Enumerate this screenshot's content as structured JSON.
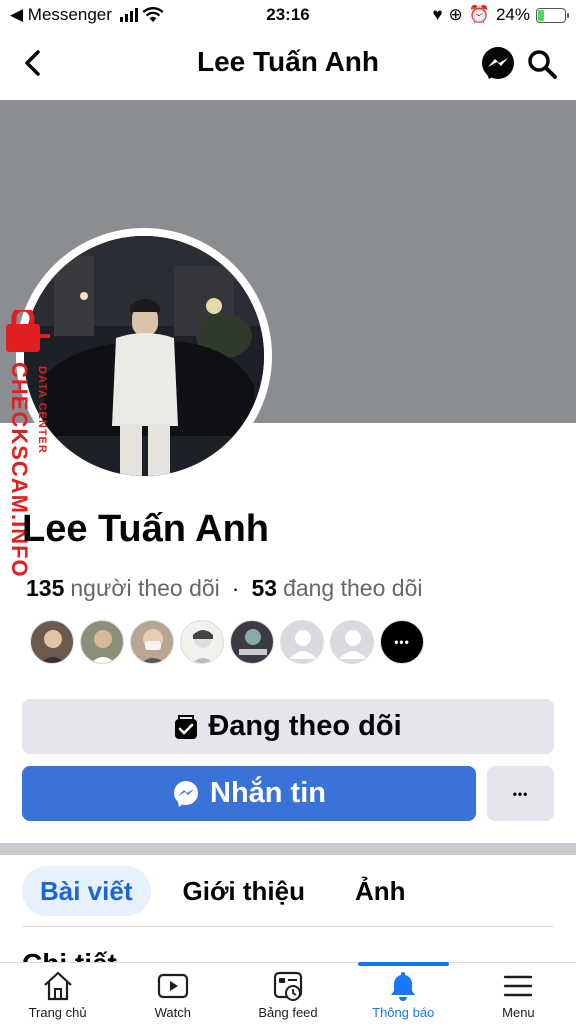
{
  "status_bar": {
    "carrier": "◀ Messenger",
    "time": "23:16",
    "battery": "24%",
    "battery_level": 0.24
  },
  "header": {
    "title": "Lee Tuấn Anh"
  },
  "watermark": {
    "text": "CHECKSCAM.INFO",
    "sub": "DATA CENTER"
  },
  "profile": {
    "name": "Lee Tuấn Anh",
    "followers_count": "135",
    "followers_label": "người theo dõi",
    "following_count": "53",
    "following_label": "đang theo dõi",
    "dot": "·",
    "more_glyph": "•••"
  },
  "buttons": {
    "following": "Đang theo dõi",
    "message": "Nhắn tin",
    "more": "•••"
  },
  "tabs": [
    {
      "label": "Bài viết",
      "active": true
    },
    {
      "label": "Giới thiệu",
      "active": false
    },
    {
      "label": "Ảnh",
      "active": false
    }
  ],
  "section": {
    "heading": "Chi tiết"
  },
  "nav": [
    {
      "label": "Trang chủ",
      "icon": "home-icon"
    },
    {
      "label": "Watch",
      "icon": "watch-icon"
    },
    {
      "label": "Bảng feed",
      "icon": "feed-icon"
    },
    {
      "label": "Thông báo",
      "icon": "bell-icon",
      "active": true
    },
    {
      "label": "Menu",
      "icon": "menu-icon"
    }
  ],
  "colors": {
    "accent": "#1877f2",
    "message_button": "#3a73d8",
    "cover": "#8a8d91",
    "watermark": "#e02020"
  }
}
